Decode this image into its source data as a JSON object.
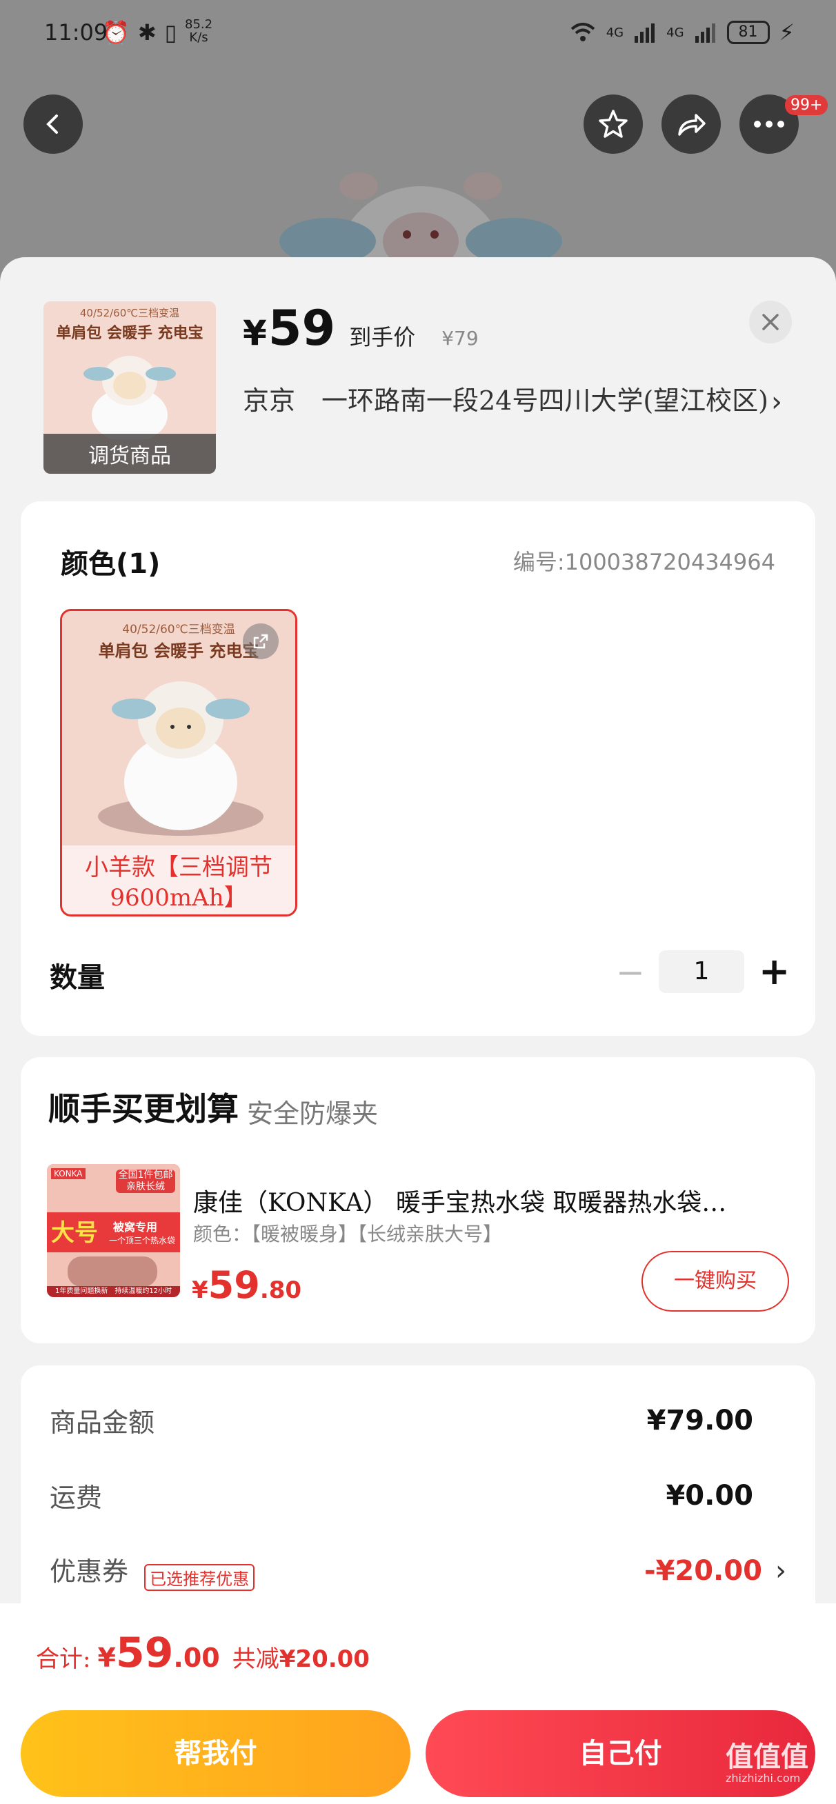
{
  "status_bar": {
    "time": "11:09",
    "speed_value": "85.2",
    "speed_unit": "K/s",
    "network_1": "4G",
    "network_2": "4G",
    "battery": "81"
  },
  "header": {
    "badge": "99+"
  },
  "product": {
    "thumb_top_text": "40/52/60℃三档变温",
    "thumb_tagline": "单肩包 会暖手 充电宝",
    "thumb_banner": "调货商品",
    "price_symbol": "¥",
    "price": "59",
    "price_label": "到手价",
    "original_price": "¥79",
    "address": "京京　一环路南一段24号四川大学(望江校区)"
  },
  "color_section": {
    "title": "颜色(1)",
    "sku": "编号:100038720434964",
    "variants": [
      {
        "img_top_text": "40/52/60℃三档变温",
        "img_tagline": "单肩包 会暖手 充电宝",
        "label": "小羊款【三档调节9600mAh】"
      }
    ]
  },
  "quantity": {
    "label": "数量",
    "minus": "−",
    "value": "1",
    "plus": "+"
  },
  "recommend": {
    "title": "顺手买更划算",
    "subtitle": "安全防爆夹",
    "item": {
      "brand_logo": "KONKA",
      "img_badge": "全国1件包邮 亲肤长绒",
      "img_big": "大号",
      "img_big_sub": "被窝专用",
      "img_small": "一个顶三个热水袋",
      "img_bottom": "1年质量问题换新　持续温暖约12小时",
      "name": "康佳（KONKA） 暖手宝热水袋 取暖器热水袋…",
      "spec": "颜色：【暖被暖身】【长绒亲肤大号】",
      "price_symbol": "¥",
      "price_int": "59",
      "price_dec": ".80",
      "buy_label": "一键购买"
    }
  },
  "fees": {
    "goods_label": "商品金额",
    "goods_value": "¥79.00",
    "shipping_label": "运费",
    "shipping_value": "¥0.00",
    "coupon_label": "优惠券",
    "coupon_tag": "已选推荐优惠",
    "coupon_value": "-¥20.00"
  },
  "footer": {
    "total_label": "合计:",
    "total_symbol": "¥",
    "total_int": "59",
    "total_dec": ".00",
    "saved_label": "共减",
    "saved_value": "¥20.00",
    "help_pay": "帮我付",
    "self_pay": "自己付",
    "watermark": "值值值",
    "watermark_url": "zhizhizhi.com"
  },
  "colors": {
    "accent_red": "#e3312d",
    "help_button": "#ffb21c",
    "self_button": "#f0323f"
  }
}
